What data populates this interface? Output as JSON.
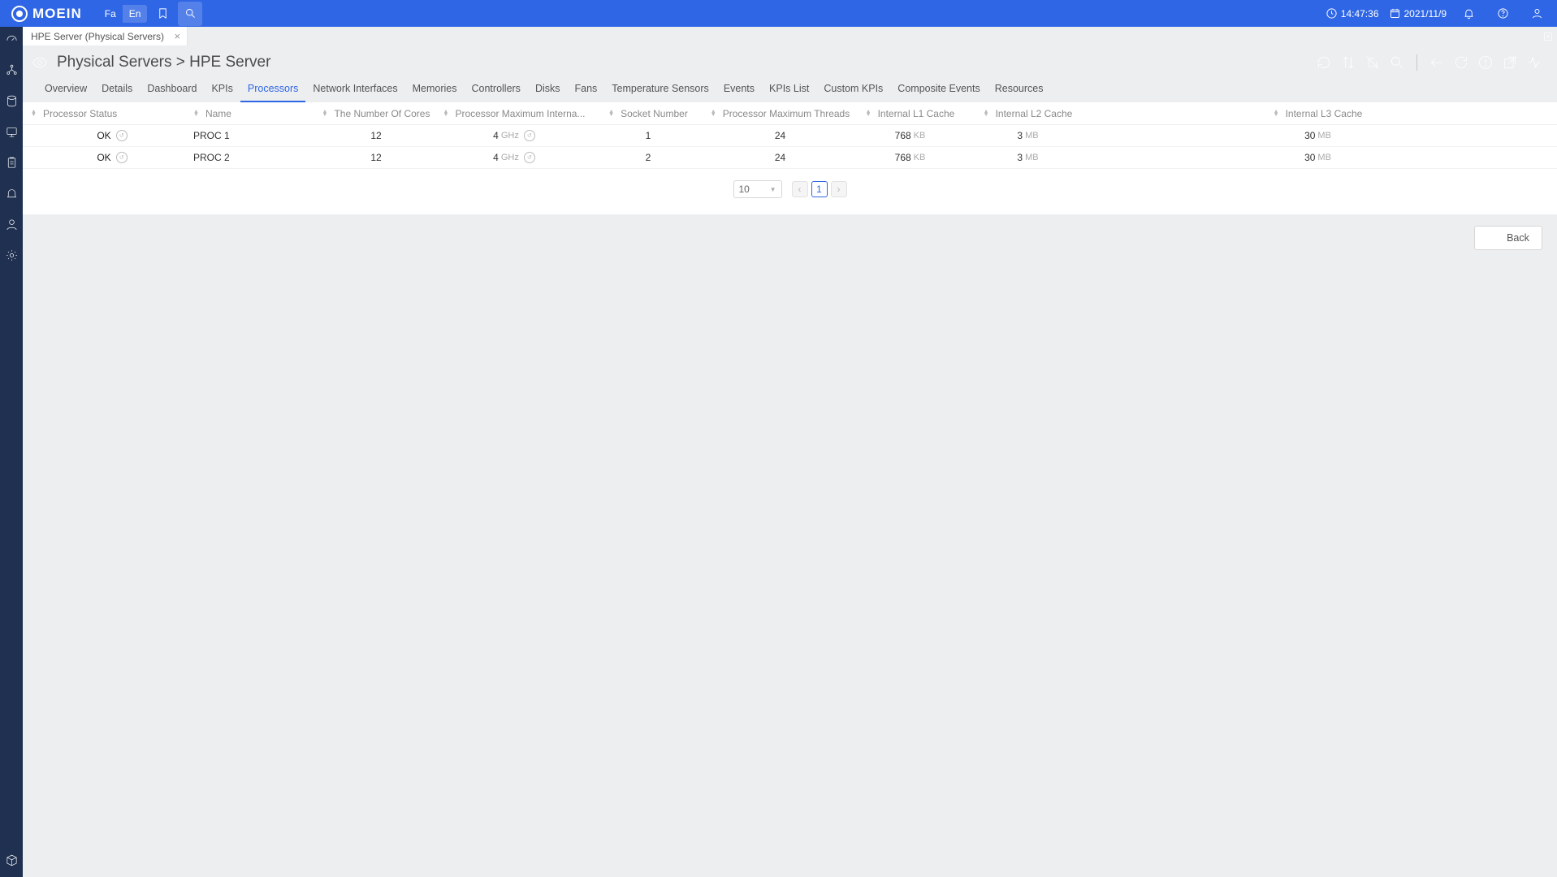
{
  "brand": "MOEIN",
  "lang": {
    "fa": "Fa",
    "en": "En"
  },
  "topbar": {
    "time": "14:47:36",
    "date": "2021/11/9"
  },
  "page_tab": {
    "label": "HPE Server (Physical Servers)"
  },
  "breadcrumb": "Physical Servers > HPE Server",
  "subtabs": [
    "Overview",
    "Details",
    "Dashboard",
    "KPIs",
    "Processors",
    "Network Interfaces",
    "Memories",
    "Controllers",
    "Disks",
    "Fans",
    "Temperature Sensors",
    "Events",
    "KPIs List",
    "Custom KPIs",
    "Composite Events",
    "Resources"
  ],
  "active_subtab_index": 4,
  "columns": [
    "Processor Status",
    "Name",
    "The Number Of Cores",
    "Processor Maximum Interna...",
    "Socket Number",
    "Processor Maximum Threads",
    "Internal L1 Cache",
    "Internal L2 Cache",
    "Internal L3 Cache"
  ],
  "rows": [
    {
      "status": "OK",
      "name": "PROC 1",
      "cores": "12",
      "freq_val": "4",
      "freq_unit": "GHz",
      "socket": "1",
      "threads": "24",
      "l1_val": "768",
      "l1_unit": "KB",
      "l2_val": "3",
      "l2_unit": "MB",
      "l3_val": "30",
      "l3_unit": "MB"
    },
    {
      "status": "OK",
      "name": "PROC 2",
      "cores": "12",
      "freq_val": "4",
      "freq_unit": "GHz",
      "socket": "2",
      "threads": "24",
      "l1_val": "768",
      "l1_unit": "KB",
      "l2_val": "3",
      "l2_unit": "MB",
      "l3_val": "30",
      "l3_unit": "MB"
    }
  ],
  "pager": {
    "size": "10",
    "page": "1"
  },
  "footer": {
    "back": "Back"
  }
}
